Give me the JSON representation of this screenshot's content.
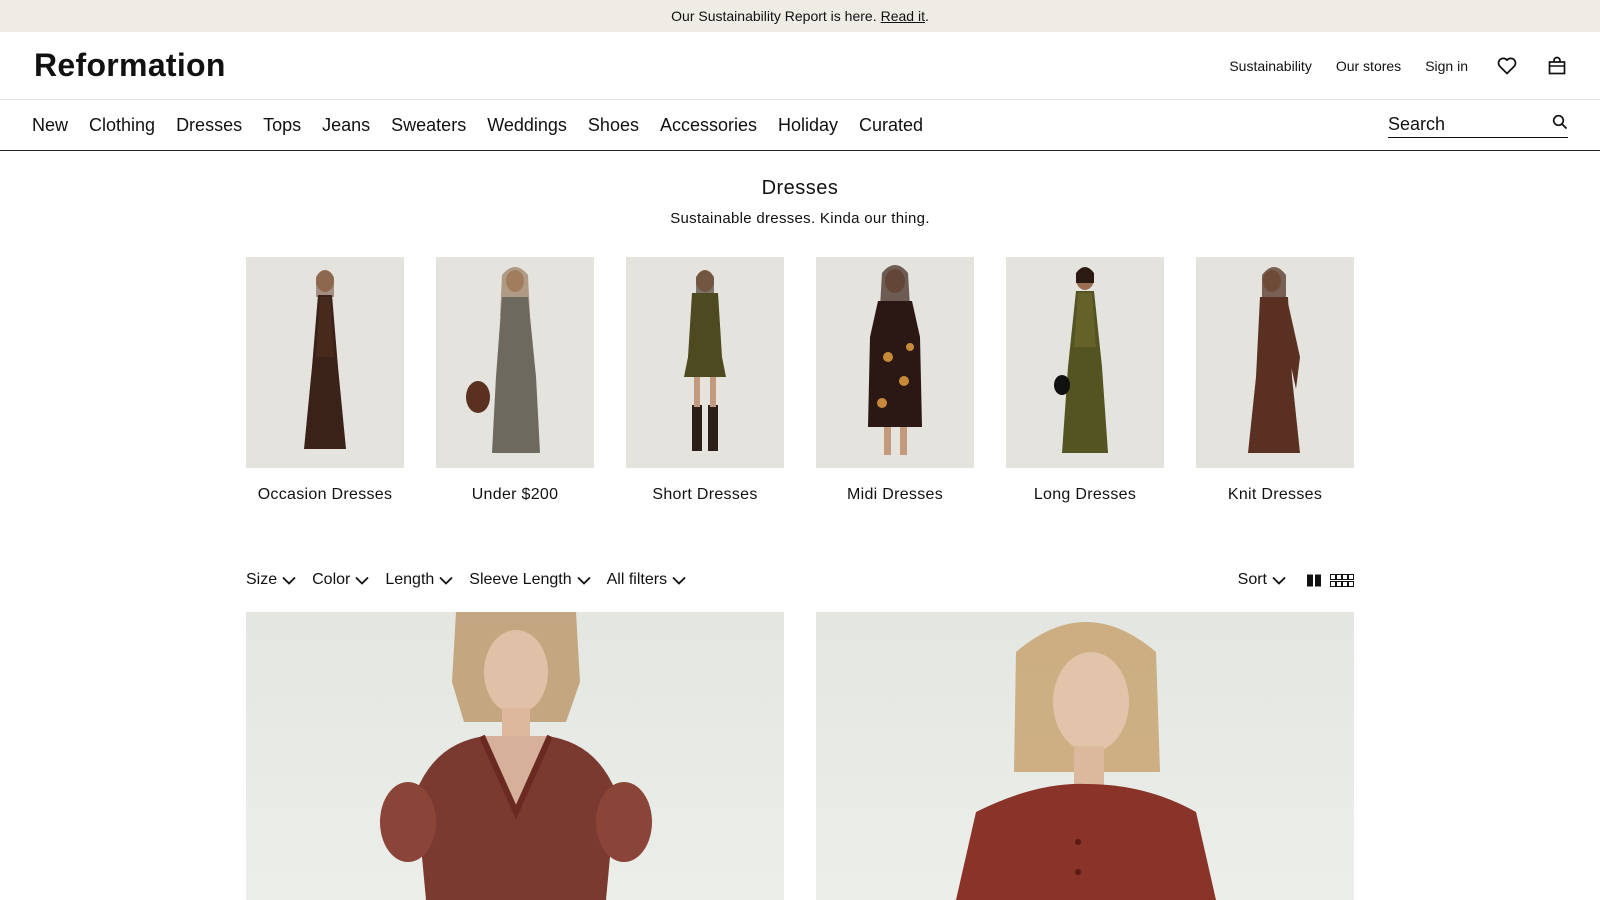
{
  "promo": {
    "text": "Our Sustainability Report is here.",
    "link": "Read it",
    "period": "."
  },
  "header": {
    "logo": "Reformation",
    "links": [
      "Sustainability",
      "Our stores",
      "Sign in"
    ],
    "icons": [
      "heart-icon",
      "bag-icon"
    ]
  },
  "nav": {
    "items": [
      "New",
      "Clothing",
      "Dresses",
      "Tops",
      "Jeans",
      "Sweaters",
      "Weddings",
      "Shoes",
      "Accessories",
      "Holiday",
      "Curated"
    ],
    "search_placeholder": "Search"
  },
  "page": {
    "title": "Dresses",
    "subtitle": "Sustainable dresses. Kinda our thing."
  },
  "categories": [
    {
      "label": "Occasion Dresses",
      "color": "#3a2219"
    },
    {
      "label": "Under $200",
      "color": "#4a463e"
    },
    {
      "label": "Short Dresses",
      "color": "#4d4a22"
    },
    {
      "label": "Midi Dresses",
      "color": "#2b1815"
    },
    {
      "label": "Long Dresses",
      "color": "#545322"
    },
    {
      "label": "Knit Dresses",
      "color": "#5a3022"
    }
  ],
  "filters": {
    "items": [
      "Size",
      "Color",
      "Length",
      "Sleeve Length",
      "All filters"
    ],
    "sort": "Sort"
  },
  "products": [
    {
      "color": "#7a3a30"
    },
    {
      "color": "#8a3328"
    }
  ]
}
